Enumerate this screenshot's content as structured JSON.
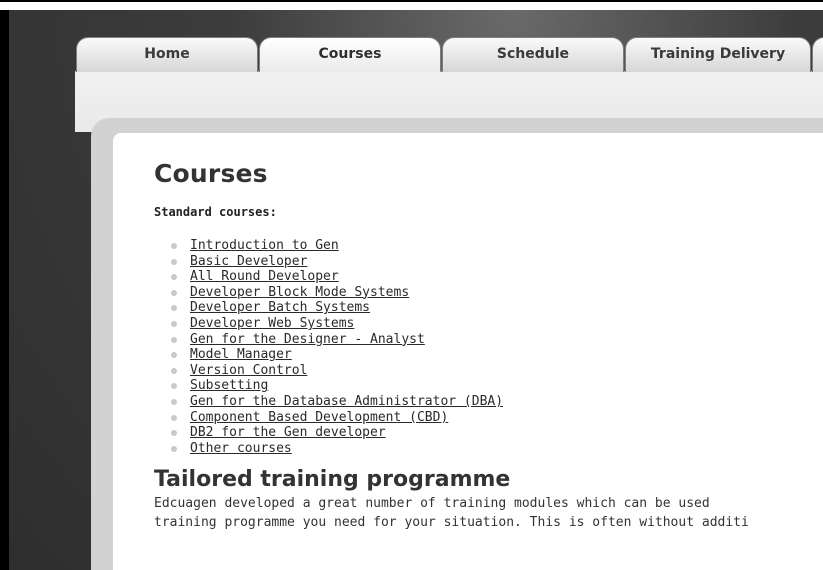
{
  "nav": {
    "tabs": [
      {
        "label": "Home"
      },
      {
        "label": "Courses"
      },
      {
        "label": "Schedule"
      },
      {
        "label": "Training Delivery"
      }
    ],
    "active_tab": "Courses"
  },
  "main": {
    "title": "Courses",
    "standard_heading": "Standard courses:",
    "courses": [
      "Introduction to Gen",
      "Basic Developer",
      "All Round Developer",
      "Developer Block Mode Systems",
      "Developer Batch Systems",
      "Developer Web Systems",
      "Gen for the Designer - Analyst",
      "Model Manager",
      "Version Control",
      "Subsetting",
      "Gen for the Database Administrator (DBA)",
      "Component Based Development (CBD)",
      "DB2 for the Gen developer",
      "Other courses"
    ],
    "tailored_heading": "Tailored training programme",
    "tailored_text_line1": "Edcuagen developed a great number of training modules which can be used",
    "tailored_text_line2": "training programme you need for your situation. This is often without additi"
  },
  "colors": {
    "background_dark": "#3c3c3c",
    "tab_gradient_top": "#fafafa",
    "panel_border": "#d2d2d2",
    "bullet": "#c9c9c9",
    "text": "#333333"
  }
}
